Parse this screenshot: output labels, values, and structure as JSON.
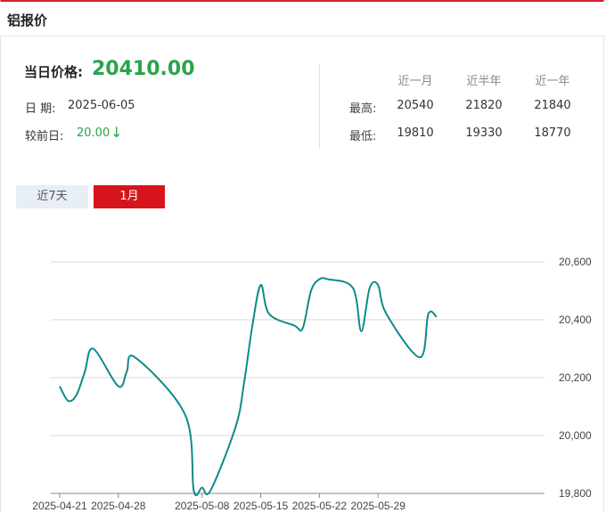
{
  "header": {
    "title": "铝报价"
  },
  "quote": {
    "price_label": "当日价格:",
    "price_value": "20410.00",
    "date_label": "日 期:",
    "date_value": "2025-06-05",
    "change_label": "较前日:",
    "change_value": "20.00",
    "change_arrow": "↓",
    "colors": {
      "price": "#2aa44a",
      "change": "#2aa44a"
    }
  },
  "stats": {
    "columns": [
      "近一月",
      "近半年",
      "近一年"
    ],
    "rows": [
      {
        "label": "最高:",
        "values": [
          "20540",
          "21820",
          "21840"
        ]
      },
      {
        "label": "最低:",
        "values": [
          "19810",
          "19330",
          "18770"
        ]
      }
    ]
  },
  "tabs": [
    {
      "label": "近7天",
      "active": false
    },
    {
      "label": "1月",
      "active": true
    }
  ],
  "chart_data": {
    "type": "line",
    "title": "",
    "xlabel": "",
    "ylabel": "",
    "ylim": [
      19800,
      20600
    ],
    "yticks": [
      19800,
      20000,
      20200,
      20400,
      20600
    ],
    "ytick_labels": [
      "19,800",
      "20,000",
      "20,200",
      "20,400",
      "20,600"
    ],
    "grid": true,
    "line_color": "#0e8a8a",
    "x_tick_labels": [
      "2025-04-21",
      "2025-04-28",
      "2025-05-08",
      "2025-05-15",
      "2025-05-22",
      "2025-05-29"
    ],
    "x": [
      "2025-04-21",
      "2025-04-22",
      "2025-04-23",
      "2025-04-24",
      "2025-04-25",
      "2025-04-28",
      "2025-04-29",
      "2025-04-30",
      "2025-05-06",
      "2025-05-07",
      "2025-05-08",
      "2025-05-09",
      "2025-05-12",
      "2025-05-13",
      "2025-05-14",
      "2025-05-15",
      "2025-05-16",
      "2025-05-19",
      "2025-05-20",
      "2025-05-21",
      "2025-05-22",
      "2025-05-23",
      "2025-05-26",
      "2025-05-27",
      "2025-05-28",
      "2025-05-29",
      "2025-05-30",
      "2025-06-03",
      "2025-06-04",
      "2025-06-05"
    ],
    "series": [
      {
        "values": [
          20170,
          20120,
          20140,
          20220,
          20300,
          20170,
          20220,
          20270,
          20070,
          19810,
          19820,
          19810,
          20030,
          20180,
          20380,
          20520,
          20420,
          20380,
          20370,
          20500,
          20540,
          20540,
          20510,
          20360,
          20510,
          20520,
          20420,
          20270,
          20420,
          20410
        ]
      }
    ]
  }
}
